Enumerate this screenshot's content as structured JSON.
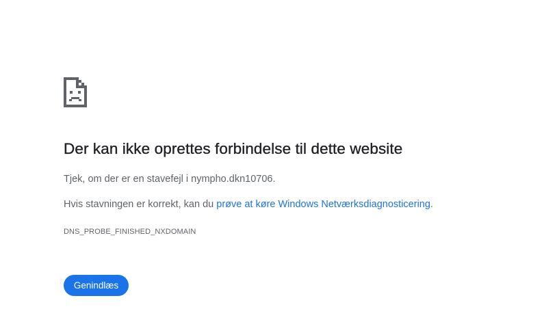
{
  "error_page": {
    "icon": "sad-page-icon",
    "heading": "Der kan ikke oprettes forbindelse til dette website",
    "check_text": "Tjek, om der er en stavefejl i nympho.dkn10706.",
    "suggestion_prefix": "Hvis stavningen er korrekt, kan du ",
    "suggestion_link": "prøve at køre Windows Netværksdiagnosticering",
    "suggestion_suffix": ".",
    "error_code": "DNS_PROBE_FINISHED_NXDOMAIN",
    "reload_label": "Genindlæs"
  },
  "colors": {
    "heading": "#202124",
    "body_text": "#5f6368",
    "link": "#1a73e8",
    "button_bg": "#1a73e8",
    "button_text": "#ffffff",
    "background": "#ffffff"
  }
}
